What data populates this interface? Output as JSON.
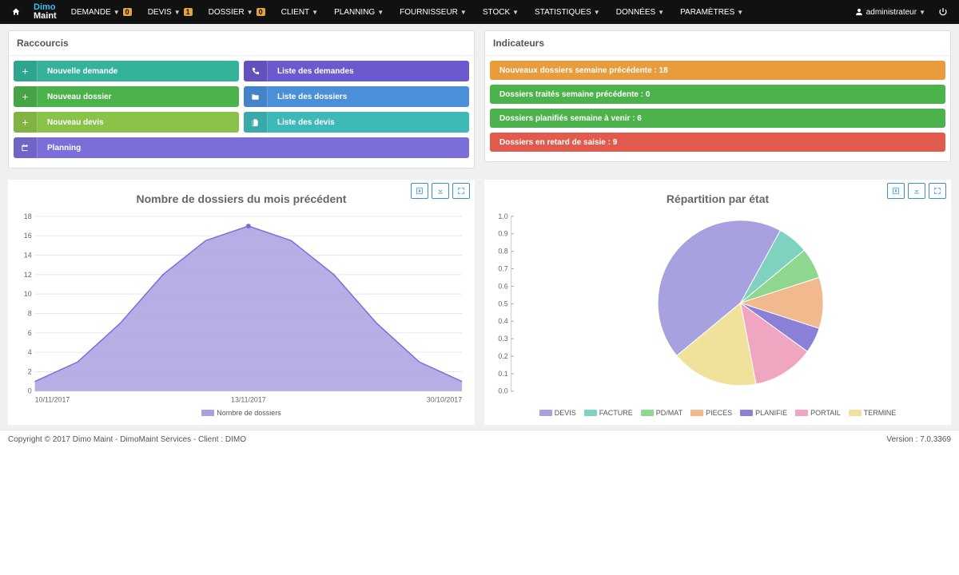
{
  "nav": {
    "items": [
      {
        "label": "DEMANDE",
        "badge": "0"
      },
      {
        "label": "DEVIS",
        "badge": "1"
      },
      {
        "label": "DOSSIER",
        "badge": "0"
      },
      {
        "label": "CLIENT"
      },
      {
        "label": "PLANNING"
      },
      {
        "label": "FOURNISSEUR"
      },
      {
        "label": "STOCK"
      },
      {
        "label": "STATISTIQUES"
      },
      {
        "label": "DONNÉES"
      },
      {
        "label": "PARAMÈTRES"
      }
    ],
    "user": "administrateur"
  },
  "shortcuts": {
    "title": "Raccourcis",
    "rows": [
      [
        {
          "icon": "+",
          "label": "Nouvelle demande",
          "color": "c-teal"
        },
        {
          "icon": "phone",
          "label": "Liste des demandes",
          "color": "c-indigo"
        }
      ],
      [
        {
          "icon": "+",
          "label": "Nouveau dossier",
          "color": "c-green"
        },
        {
          "icon": "folder",
          "label": "Liste des dossiers",
          "color": "c-blue"
        }
      ],
      [
        {
          "icon": "+",
          "label": "Nouveau devis",
          "color": "c-lime"
        },
        {
          "icon": "docs",
          "label": "Liste des devis",
          "color": "c-cyan"
        }
      ],
      [
        {
          "icon": "calendar",
          "label": "Planning",
          "color": "c-violet",
          "full": true
        }
      ]
    ]
  },
  "indicators": {
    "title": "Indicateurs",
    "items": [
      {
        "label": "Nouveaux dossiers semaine précédente : 18",
        "color": "c-orange"
      },
      {
        "label": "Dossiers traités semaine précédente : 0",
        "color": "c-green"
      },
      {
        "label": "Dossiers planifiés semaine à venir : 6",
        "color": "c-green"
      },
      {
        "label": "Dossiers en retard de saisie : 9",
        "color": "c-red"
      }
    ]
  },
  "chart_data": [
    {
      "type": "area",
      "title": "Nombre de dossiers du mois précédent",
      "x_ticks": [
        "10/11/2017",
        "13/11/2017",
        "30/10/2017"
      ],
      "y_ticks": [
        0,
        2,
        4,
        6,
        8,
        10,
        12,
        14,
        16,
        18
      ],
      "ylim": [
        0,
        18
      ],
      "series": [
        {
          "name": "Nombre de dossiers",
          "color": "#a8a1e0"
        }
      ],
      "points": [
        {
          "x": 0.0,
          "y": 1
        },
        {
          "x": 0.1,
          "y": 3
        },
        {
          "x": 0.2,
          "y": 7
        },
        {
          "x": 0.3,
          "y": 12
        },
        {
          "x": 0.4,
          "y": 15.5
        },
        {
          "x": 0.5,
          "y": 17
        },
        {
          "x": 0.6,
          "y": 15.5
        },
        {
          "x": 0.7,
          "y": 12
        },
        {
          "x": 0.8,
          "y": 7
        },
        {
          "x": 0.9,
          "y": 3
        },
        {
          "x": 1.0,
          "y": 1
        }
      ]
    },
    {
      "type": "pie",
      "title": "Répartition par état",
      "y_ticks": [
        0,
        0.1,
        0.2,
        0.3,
        0.4,
        0.5,
        0.6,
        0.7,
        0.8,
        0.9,
        1.0
      ],
      "series": [
        {
          "name": "DEVIS",
          "value": 0.44,
          "color": "#a8a1e0"
        },
        {
          "name": "FACTURE",
          "value": 0.06,
          "color": "#7fd1c0"
        },
        {
          "name": "PD/MAT",
          "value": 0.06,
          "color": "#8fd68f"
        },
        {
          "name": "PIECES",
          "value": 0.1,
          "color": "#f2b98f"
        },
        {
          "name": "PLANIFIE",
          "value": 0.05,
          "color": "#8b80d8"
        },
        {
          "name": "PORTAIL",
          "value": 0.12,
          "color": "#f0a6c0"
        },
        {
          "name": "TERMINE",
          "value": 0.17,
          "color": "#f0e29a"
        }
      ]
    }
  ],
  "footer": {
    "copyright": "Copyright © 2017 Dimo Maint - DimoMaint Services - Client : DIMO",
    "version": "Version : 7.0.3369"
  }
}
